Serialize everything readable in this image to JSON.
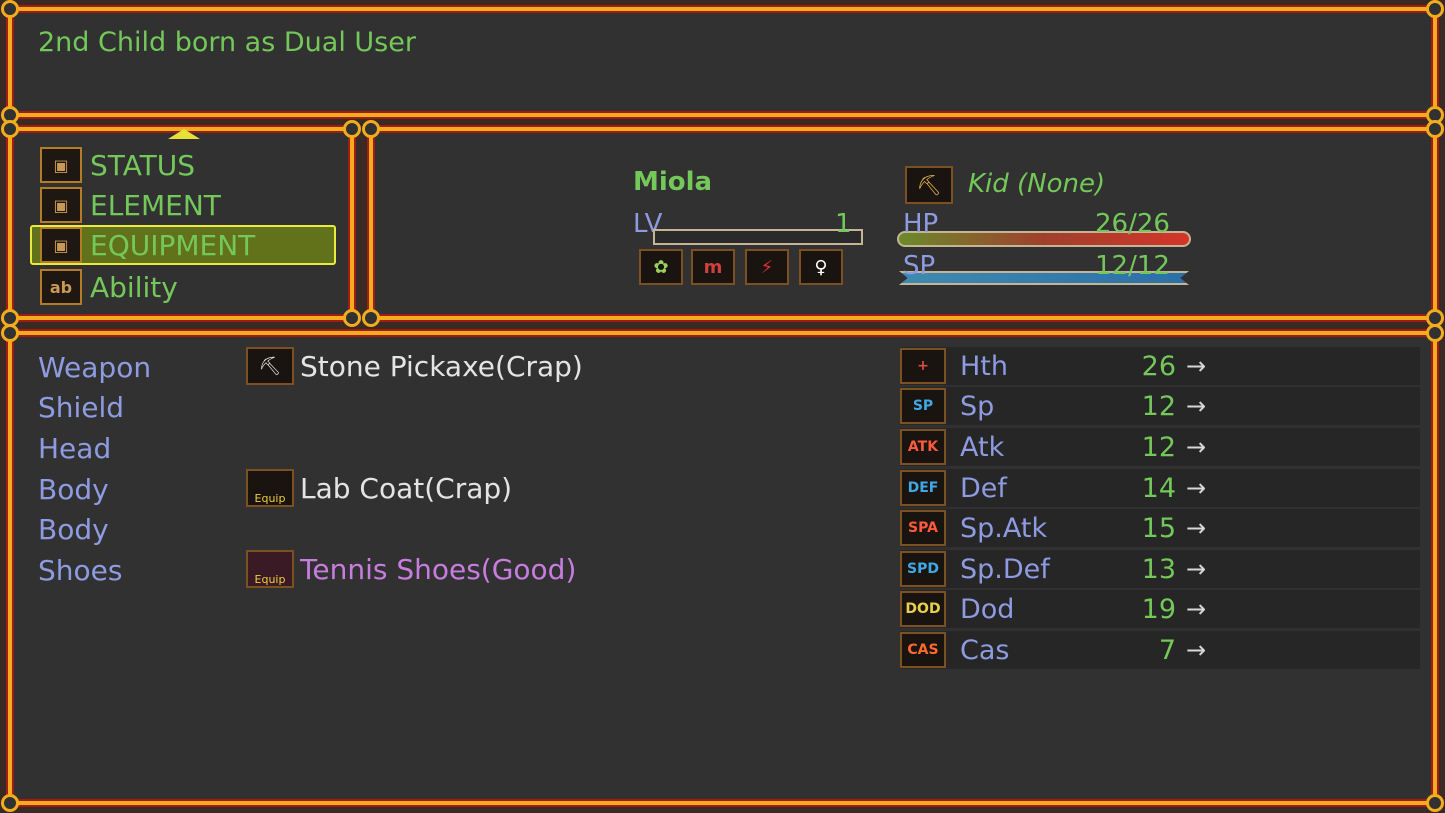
{
  "message": {
    "text": "2nd Child born as Dual User"
  },
  "menu": {
    "items": [
      {
        "label": "STATUS",
        "icon": "book-icon"
      },
      {
        "label": "ELEMENT",
        "icon": "book-icon"
      },
      {
        "label": "EQUIPMENT",
        "icon": "book-icon",
        "selected": true
      },
      {
        "label": "Ability",
        "icon": "ability-icon",
        "icon_text": "ab"
      }
    ]
  },
  "character": {
    "name": "Miola",
    "lv_label": "LV",
    "lv_value": "1",
    "type_icon": "pickaxe-type-icon",
    "type_text": "Kid (None)",
    "hp_label": "HP",
    "hp_value": "26/26",
    "sp_label": "SP",
    "sp_value": "12/12",
    "status_icons": [
      {
        "name": "dual-user-icon",
        "glyph": "✿",
        "color": "#9ad060"
      },
      {
        "name": "potion-icon",
        "glyph": "m",
        "color": "#d04040"
      },
      {
        "name": "element-icon",
        "glyph": "⚡",
        "color": "#4040d0"
      },
      {
        "name": "female-icon",
        "glyph": "♀",
        "color": "#ffffff"
      }
    ]
  },
  "equipment": {
    "slots": [
      {
        "label": "Weapon",
        "item": "Stone Pickaxe(Crap)",
        "icon": "pickaxe-icon",
        "glyph": "⛏",
        "quality": "crap"
      },
      {
        "label": "Shield",
        "item": "",
        "icon": "",
        "glyph": "",
        "quality": ""
      },
      {
        "label": "Head",
        "item": "",
        "icon": "",
        "glyph": "",
        "quality": ""
      },
      {
        "label": "Body",
        "item": "Lab Coat(Crap)",
        "icon": "lab-coat-icon",
        "glyph": "Equip",
        "quality": "crap"
      },
      {
        "label": "Body",
        "item": "",
        "icon": "",
        "glyph": "",
        "quality": ""
      },
      {
        "label": "Shoes",
        "item": "Tennis Shoes(Good)",
        "icon": "tennis-shoes-icon",
        "glyph": "Equip",
        "quality": "good"
      }
    ]
  },
  "stats": [
    {
      "name": "Hth",
      "value": "26",
      "icon": "health-icon",
      "icon_text": "+",
      "icon_color": "#e04a4a"
    },
    {
      "name": "Sp",
      "value": "12",
      "icon": "sp-icon",
      "icon_text": "SP",
      "icon_color": "#3fa9e8"
    },
    {
      "name": "Atk",
      "value": "12",
      "icon": "atk-icon",
      "icon_text": "ATK",
      "icon_color": "#ff5a3a"
    },
    {
      "name": "Def",
      "value": "14",
      "icon": "def-icon",
      "icon_text": "DEF",
      "icon_color": "#3fa9e8"
    },
    {
      "name": "Sp.Atk",
      "value": "15",
      "icon": "sp-atk-icon",
      "icon_text": "SPA",
      "icon_color": "#ff5a3a"
    },
    {
      "name": "Sp.Def",
      "value": "13",
      "icon": "sp-def-icon",
      "icon_text": "SPD",
      "icon_color": "#3fa9e8"
    },
    {
      "name": "Dod",
      "value": "19",
      "icon": "dodge-icon",
      "icon_text": "DOD",
      "icon_color": "#e8d04a"
    },
    {
      "name": "Cas",
      "value": "7",
      "icon": "cast-icon",
      "icon_text": "CAS",
      "icon_color": "#ff6a2a"
    }
  ],
  "arrow_glyph": "→"
}
